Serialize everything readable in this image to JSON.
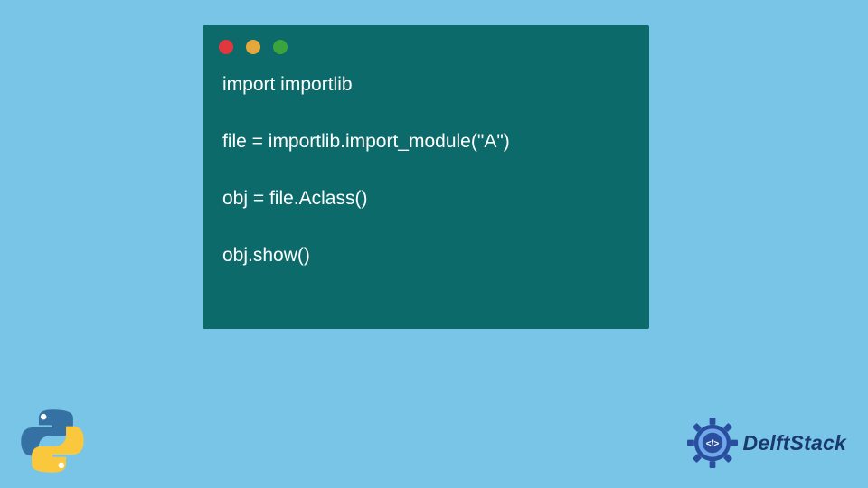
{
  "code": {
    "lines": [
      "import importlib",
      "",
      "file = importlib.import_module(\"A\")",
      "",
      "obj = file.Aclass()",
      "",
      "obj.show()"
    ]
  },
  "brand": {
    "name": "DelftStack"
  },
  "icons": {
    "python": "python-logo",
    "gear": "delftstack-gear"
  },
  "colors": {
    "bg": "#79c5e8",
    "window": "#0d6a6a",
    "text": "#ffffff",
    "brand": "#1a3a6e"
  }
}
